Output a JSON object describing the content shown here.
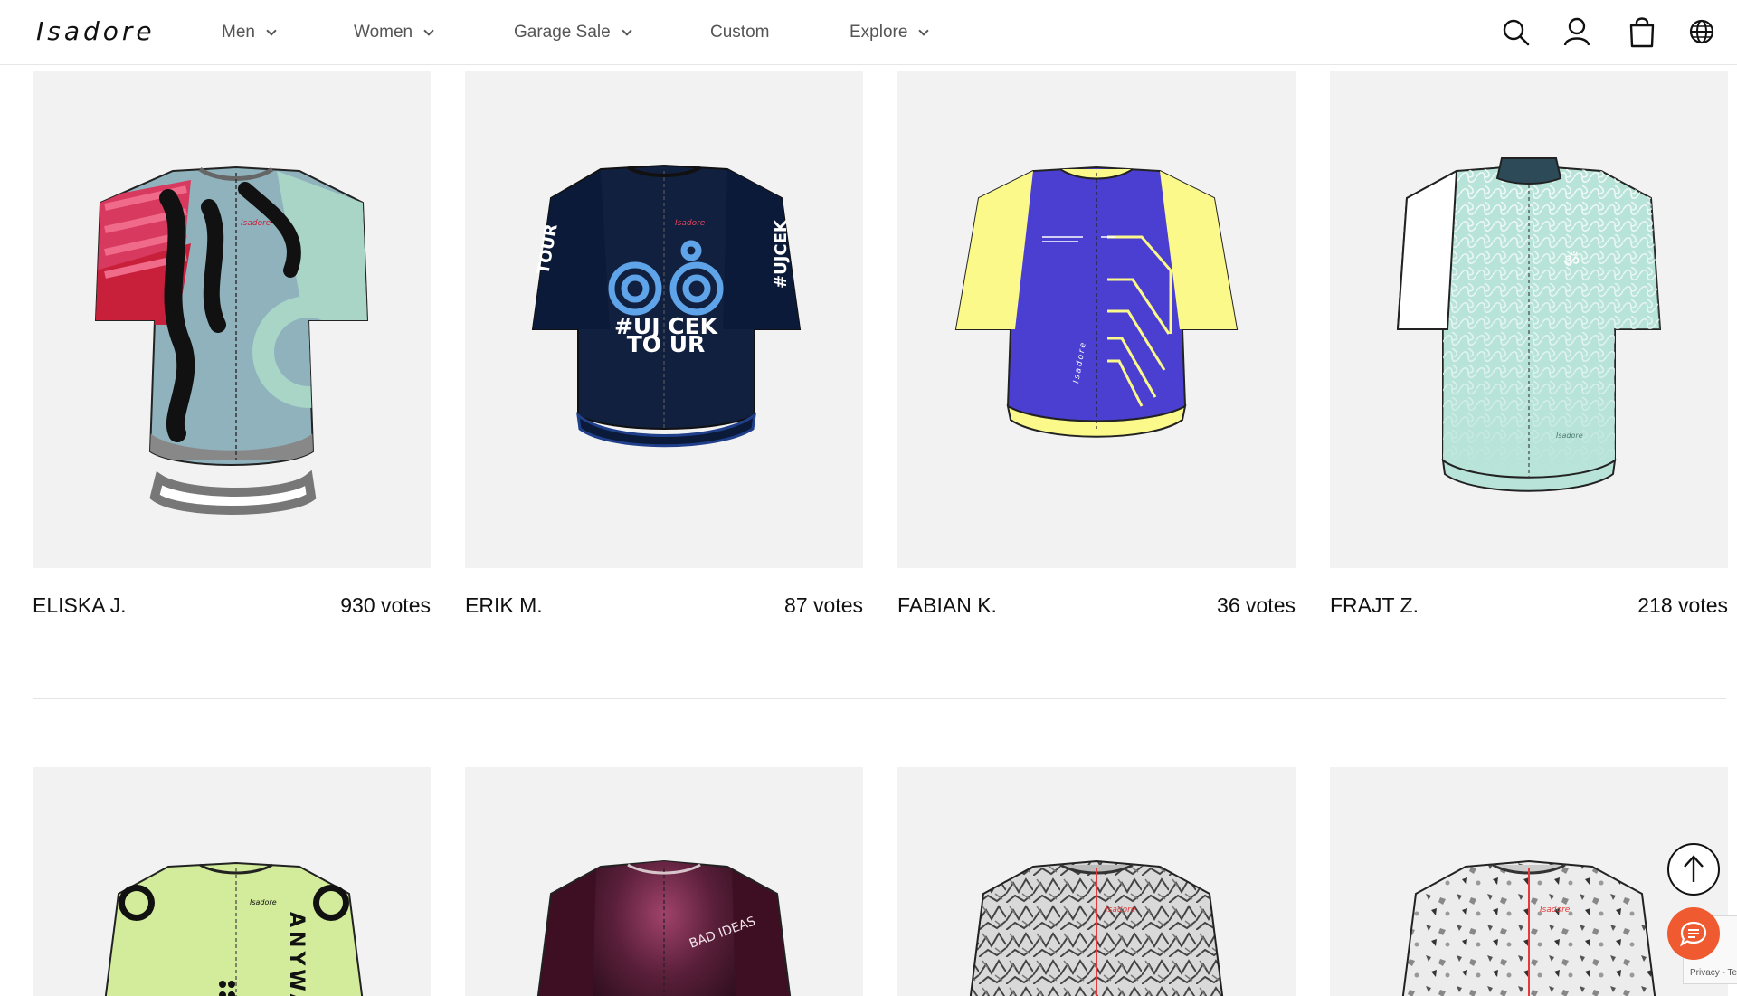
{
  "header": {
    "logo": "Isadore",
    "nav": [
      {
        "label": "Men",
        "dropdown": true
      },
      {
        "label": "Women",
        "dropdown": true
      },
      {
        "label": "Garage Sale",
        "dropdown": true
      },
      {
        "label": "Custom",
        "dropdown": false
      },
      {
        "label": "Explore",
        "dropdown": true
      }
    ],
    "icons": [
      "search-icon",
      "account-icon",
      "cart-icon",
      "globe-icon"
    ]
  },
  "designs": [
    {
      "name": "ELISKA J.",
      "votes": "930 votes"
    },
    {
      "name": "ERIK M.",
      "votes": "87 votes"
    },
    {
      "name": "FABIAN K.",
      "votes": "36 votes"
    },
    {
      "name": "FRAJT Z.",
      "votes": "218 votes"
    }
  ],
  "jersey_text": {
    "brand_mark": "Isadore",
    "erik_front": "#UJ CEK\nTO UR",
    "erik_left_sleeve": "TOUR",
    "erik_right_sleeve": "#UJCEK",
    "frajt_symbol": "ॐ",
    "row2_text": "ANYWAY",
    "row2_bad": "BAD IDEAS"
  },
  "floating": {
    "to_top_icon": "arrow-up-icon",
    "chat_icon": "chat-icon",
    "recaptcha_text": "Privacy - Te"
  },
  "colors": {
    "accent_chat": "#f05a30",
    "card_bg": "#f2f2f2"
  }
}
